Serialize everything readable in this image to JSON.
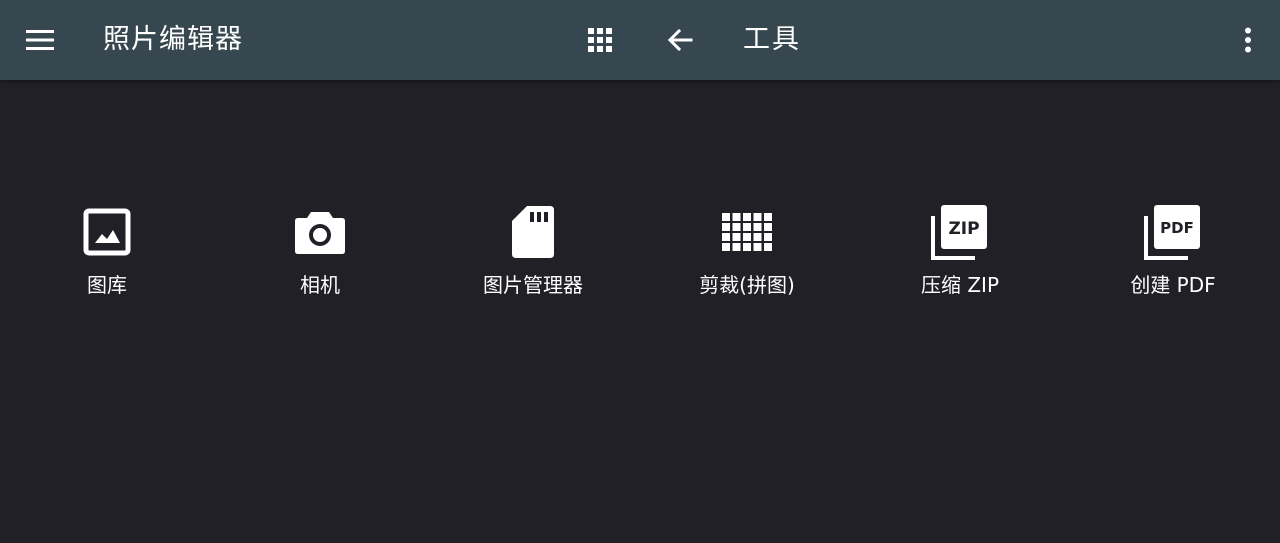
{
  "appbar": {
    "menu_icon": "hamburger-menu-icon",
    "app_title": "照片编辑器",
    "grid_icon": "apps-grid-icon",
    "back_icon": "arrow-back-icon",
    "section_title": "工具",
    "more_icon": "more-vert-icon",
    "background_color": "#37474f"
  },
  "tools": [
    {
      "label": "图库",
      "icon": "image-icon"
    },
    {
      "label": "相机",
      "icon": "camera-icon"
    },
    {
      "label": "图片管理器",
      "icon": "sd-card-icon"
    },
    {
      "label": "剪裁(拼图)",
      "icon": "grid-split-icon"
    },
    {
      "label": "压缩 ZIP",
      "icon": "zip-icon",
      "badge": "ZIP"
    },
    {
      "label": "创建 PDF",
      "icon": "pdf-icon",
      "badge": "PDF"
    }
  ],
  "colors": {
    "background": "#212027",
    "foreground": "#ffffff"
  }
}
